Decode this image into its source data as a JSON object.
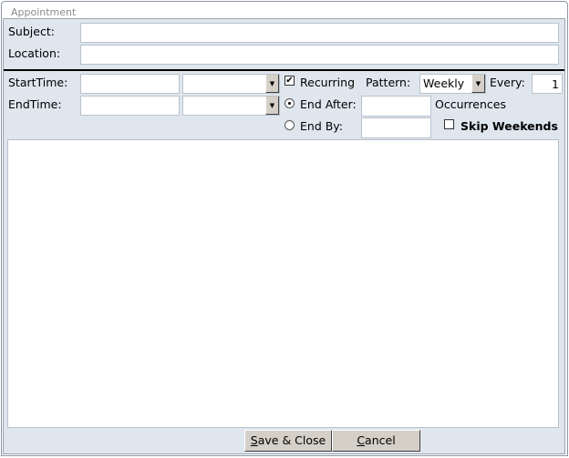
{
  "window": {
    "title": "Appointment"
  },
  "form": {
    "subject_label": "Subject:",
    "subject_value": "",
    "location_label": "Location:",
    "location_value": "",
    "start_label": "StartTime:",
    "start_date": "",
    "start_time": "",
    "end_label": "EndTime:",
    "end_date": "",
    "end_time": "",
    "recurring_label": "Recurring",
    "recurring_checked": true,
    "pattern_label": "Pattern:",
    "pattern_value": "Weekly",
    "every_label": "Every:",
    "every_value": "1",
    "end_after_label": "End After:",
    "end_after_selected": true,
    "end_after_value": "",
    "occurrences_label": "Occurrences",
    "end_by_label": "End By:",
    "end_by_value": "",
    "skip_weekends_label": "Skip Weekends",
    "skip_weekends_checked": false,
    "notes_value": ""
  },
  "buttons": {
    "save_first": "S",
    "save_rest": "ave & Close",
    "cancel_first": "C",
    "cancel_rest": "ancel"
  },
  "icons": {
    "dropdown": "chevron-down-icon",
    "check": "checkmark-icon"
  }
}
